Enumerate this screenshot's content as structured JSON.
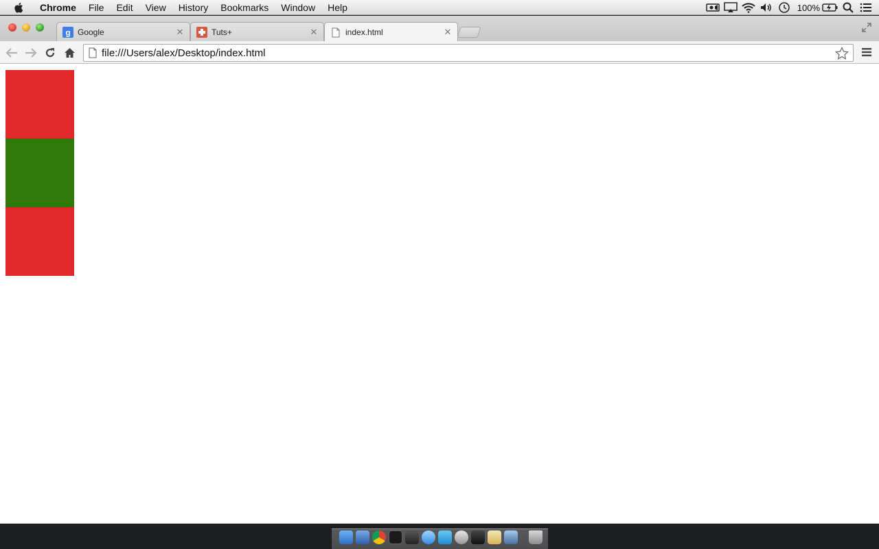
{
  "menubar": {
    "app_name": "Chrome",
    "items": [
      "File",
      "Edit",
      "View",
      "History",
      "Bookmarks",
      "Window",
      "Help"
    ],
    "battery_text": "100%"
  },
  "tabs": [
    {
      "title": "Google",
      "favicon": "google-favicon",
      "active": false
    },
    {
      "title": "Tuts+",
      "favicon": "tutsplus-favicon",
      "active": false
    },
    {
      "title": "index.html",
      "favicon": "page-icon",
      "active": true
    }
  ],
  "toolbar": {
    "url": "file:///Users/alex/Desktop/index.html"
  },
  "page": {
    "blocks": [
      {
        "color": "#e0292b"
      },
      {
        "color": "#2f7a0b"
      },
      {
        "color": "#e0292b"
      }
    ]
  },
  "colors": {
    "red_block": "#e0292b",
    "green_block": "#2f7a0b"
  },
  "dock": {
    "icons": [
      "finder-icon",
      "app-store-icon",
      "chrome-icon",
      "terminal-icon",
      "sublime-icon",
      "messages-icon",
      "twitter-icon",
      "disk-utility-icon",
      "preview-icon",
      "textedit-icon",
      "photos-icon",
      "trash-icon"
    ]
  }
}
